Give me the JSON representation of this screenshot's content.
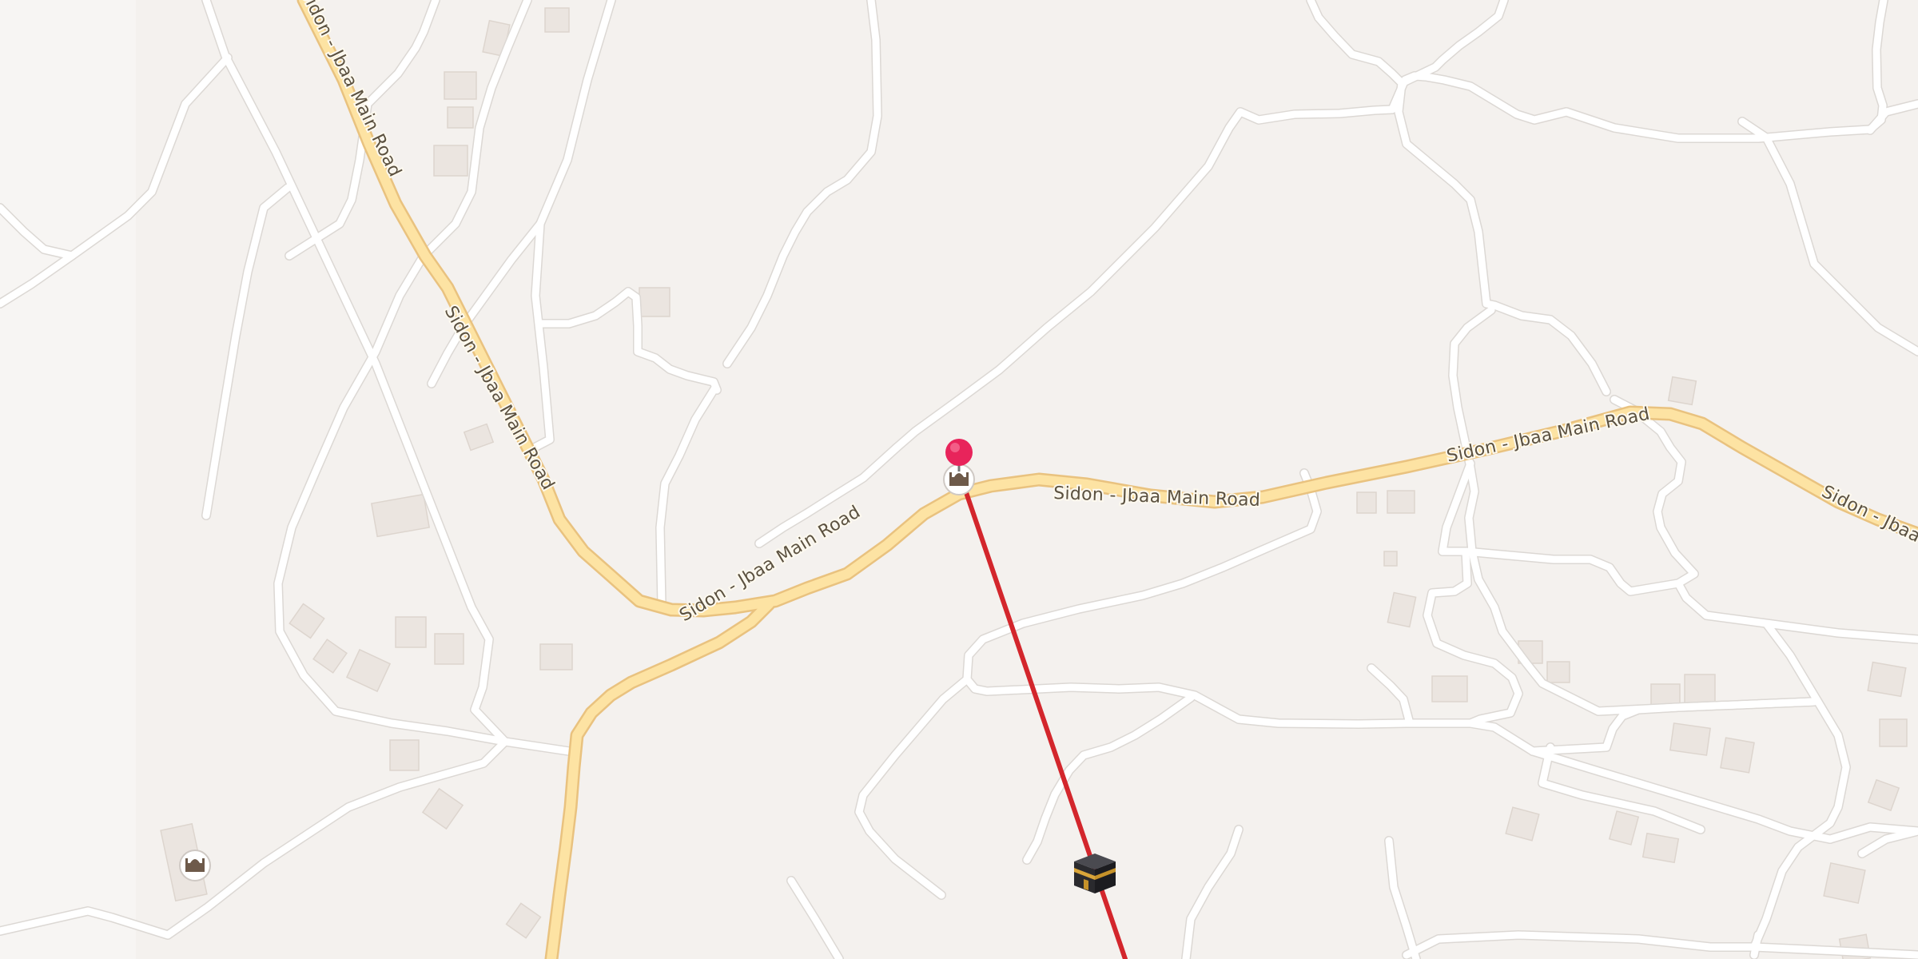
{
  "map": {
    "road_name": "Sidon - Jbaa Main Road",
    "colors": {
      "background": "#f4f1ee",
      "minor_road": "#ffffff",
      "main_road_fill": "#fde3a3",
      "main_road_casing": "#e9c27f",
      "building": "#ebe5e0",
      "direction_line": "#d3262c",
      "location_pin": "#e8245b"
    },
    "pois": [
      {
        "name": "mosque",
        "icon": "mosque-icon"
      },
      {
        "name": "mosque",
        "icon": "mosque-icon"
      }
    ],
    "user_location": {
      "icon": "location-pin-icon"
    },
    "destination": {
      "name": "Kaaba",
      "icon": "kaaba-icon"
    }
  }
}
